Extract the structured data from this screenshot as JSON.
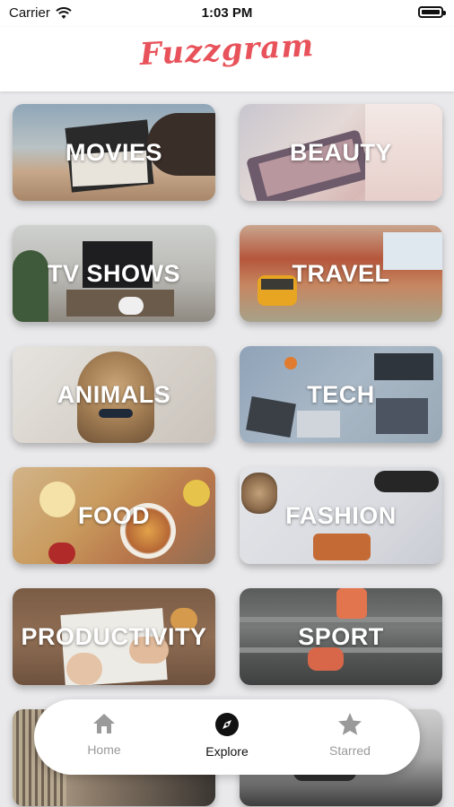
{
  "status": {
    "carrier": "Carrier",
    "time": "1:03 PM",
    "wifi_icon": "wifi-icon",
    "battery_icon": "battery-icon"
  },
  "app": {
    "title": "Fuzzgram",
    "brand_color": "#e8525a"
  },
  "categories": [
    {
      "label": "MOVIES"
    },
    {
      "label": "BEAUTY"
    },
    {
      "label": "TV SHOWS"
    },
    {
      "label": "TRAVEL"
    },
    {
      "label": "ANIMALS"
    },
    {
      "label": "TECH"
    },
    {
      "label": "FOOD"
    },
    {
      "label": "FASHION"
    },
    {
      "label": "PRODUCTIVITY"
    },
    {
      "label": "SPORT"
    }
  ],
  "tabs": {
    "home": {
      "label": "Home",
      "icon": "home-icon",
      "active": false
    },
    "explore": {
      "label": "Explore",
      "icon": "compass-icon",
      "active": true
    },
    "starred": {
      "label": "Starred",
      "icon": "star-icon",
      "active": false
    }
  },
  "colors": {
    "tab_active": "#111111",
    "tab_inactive": "#9a9a9a"
  }
}
